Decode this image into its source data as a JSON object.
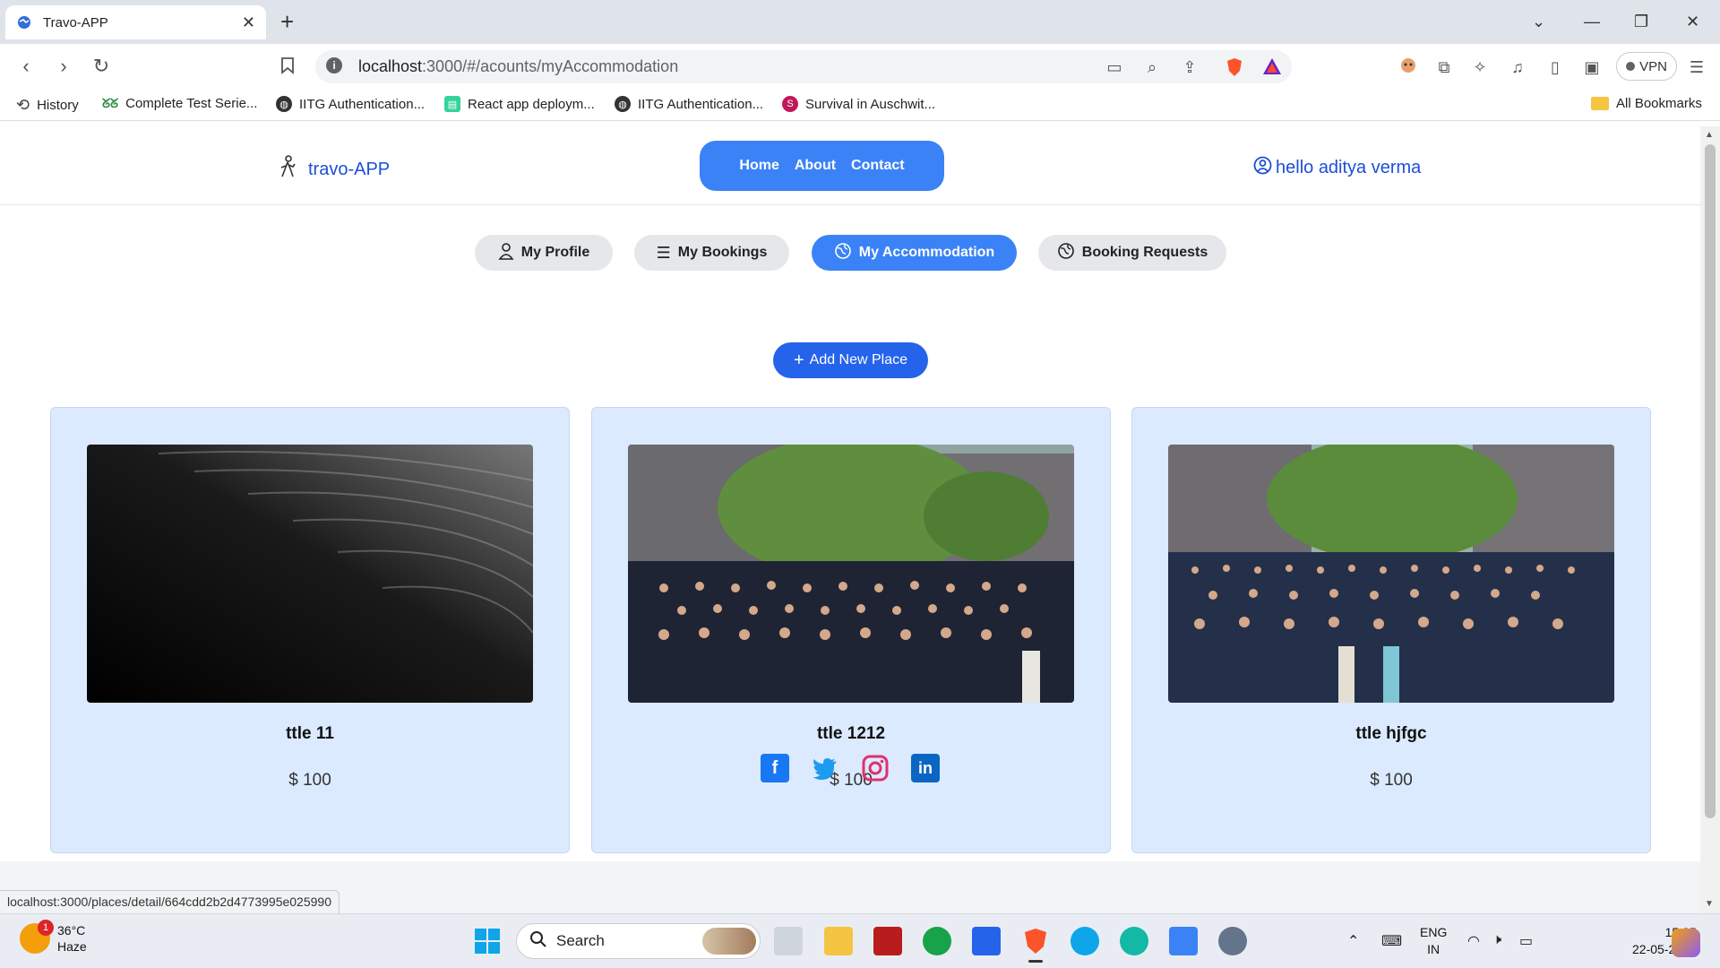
{
  "browser": {
    "tab_title": "Travo-APP",
    "tab_close": "✕",
    "new_tab": "+",
    "url_host": "localhost",
    "url_path": ":3000/#/acounts/myAccommodation",
    "vpn_label": "VPN",
    "bookmarks": [
      {
        "label": "History",
        "icon": "history-icon"
      },
      {
        "label": "Complete Test Serie...",
        "icon": "gfg-icon"
      },
      {
        "label": "IITG Authentication...",
        "icon": "globe-icon"
      },
      {
        "label": "React app deploym...",
        "icon": "page-icon"
      },
      {
        "label": "IITG Authentication...",
        "icon": "globe-icon"
      },
      {
        "label": "Survival in Auschwit...",
        "icon": "s-icon"
      }
    ],
    "all_bookmarks": "All Bookmarks",
    "status_url": "localhost:3000/places/detail/664cdd2b2d4773995e025990"
  },
  "site": {
    "brand": "travo-APP",
    "nav": [
      "Home",
      "About",
      "Contact"
    ],
    "user_greeting": "hello aditya verma",
    "tabs": [
      {
        "label": "My Profile",
        "icon": "user-icon",
        "active": false
      },
      {
        "label": "My Bookings",
        "icon": "list-icon",
        "active": false
      },
      {
        "label": "My Accommodation",
        "icon": "globe-icon",
        "active": true
      },
      {
        "label": "Booking Requests",
        "icon": "globe-icon",
        "active": false
      }
    ],
    "add_button": "Add New Place",
    "places": [
      {
        "title": "ttle 11",
        "price": "$ 100",
        "image": "dark-abstract"
      },
      {
        "title": "ttle 1212",
        "image": "group-photo",
        "price": "$ 100"
      },
      {
        "title": "ttle hjfgc",
        "image": "group-photo",
        "price": "$ 100"
      }
    ],
    "social": [
      "facebook-icon",
      "twitter-icon",
      "instagram-icon",
      "linkedin-icon"
    ]
  },
  "taskbar": {
    "temperature": "36°C",
    "weather": "Haze",
    "notification_count": "1",
    "search_placeholder": "Search",
    "lang_line1": "ENG",
    "lang_line2": "IN",
    "time": "15:25",
    "date": "22-05-2024"
  },
  "colors": {
    "accent": "#3b82f6",
    "brand_text": "#1d4ed8",
    "card_bg": "#dbeafe"
  }
}
